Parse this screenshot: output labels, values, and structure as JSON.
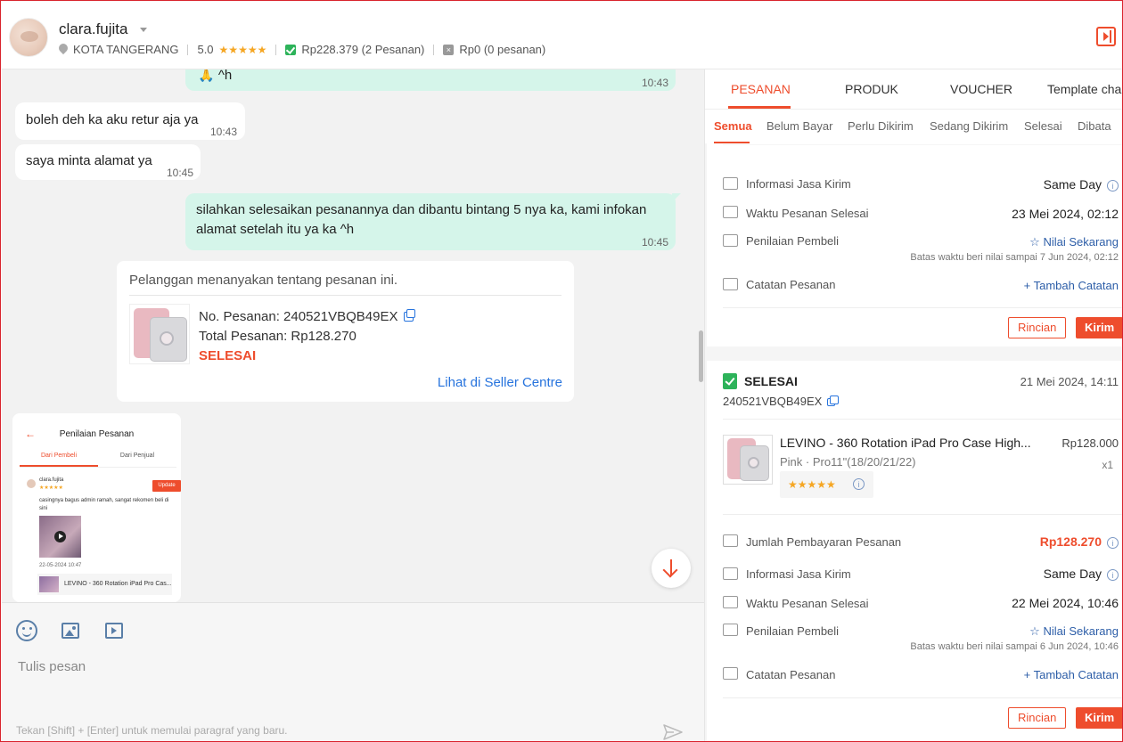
{
  "header": {
    "username": "clara.fujita",
    "location": "KOTA TANGERANG",
    "rating": "5.0",
    "stars": "★★★★★",
    "completed_orders": "Rp228.379 (2 Pesanan)",
    "other_orders": "Rp0 (0 pesanan)"
  },
  "chat": {
    "messages": [
      {
        "direction": "out",
        "text": "🙏 ^h",
        "time": "10:43"
      },
      {
        "direction": "in",
        "text": "boleh deh ka aku retur aja ya",
        "time": "10:43"
      },
      {
        "direction": "in",
        "text": "saya minta alamat ya",
        "time": "10:45"
      },
      {
        "direction": "out",
        "text": "silahkan selesaikan pesanannya dan dibantu bintang 5 nya ka, kami infokan alamat setelah itu ya ka ^h",
        "time": "10:45"
      }
    ],
    "order_card": {
      "question": "Pelanggan menanyakan tentang pesanan ini.",
      "order_no": "No. Pesanan: 240521VBQB49EX",
      "total": "Total Pesanan: Rp128.270",
      "status": "SELESAI",
      "link": "Lihat di Seller Centre"
    },
    "screenshot": {
      "title": "Penilaian Pesanan",
      "tab_buyer": "Dari Pembeli",
      "tab_seller": "Dari Penjual",
      "user": "clara.fujita",
      "stars": "★★★★★",
      "update": "Update",
      "review": "casingnya bagus admin ramah, sangat rekomen beli di sini",
      "date": "22-05-2024 10:47",
      "product": "LEVINO - 360 Rotation iPad Pro Cas..."
    }
  },
  "composer": {
    "placeholder": "Tulis pesan",
    "hint": "Tekan [Shift] + [Enter] untuk memulai paragraf yang baru."
  },
  "panel": {
    "tabs": [
      "PESANAN",
      "PRODUK",
      "VOUCHER",
      "Template cha"
    ],
    "subtabs": [
      "Semua",
      "Belum Bayar",
      "Perlu Dikirim",
      "Sedang Dikirim",
      "Selesai",
      "Dibata"
    ],
    "order1": {
      "shipping_label": "Informasi Jasa Kirim",
      "shipping_value": "Same Day",
      "completed_label": "Waktu Pesanan Selesai",
      "completed_value": "23 Mei 2024, 02:12",
      "rating_label": "Penilaian Pembeli",
      "rating_value": "Nilai Sekarang",
      "rating_note": "Batas waktu beri nilai sampai 7 Jun 2024, 02:12",
      "notes_label": "Catatan Pesanan",
      "notes_value": "Tambah Catatan",
      "btn_detail": "Rincian",
      "btn_send": "Kirim"
    },
    "order2": {
      "status": "SELESAI",
      "date": "21 Mei 2024, 14:11",
      "order_no": "240521VBQB49EX",
      "product_name": "LEVINO - 360 Rotation iPad Pro Case High...",
      "variant": "Pink · Pro11\"(18/20/21/22)",
      "price": "Rp128.000",
      "qty": "x1",
      "stars": "★★★★★",
      "payment_label": "Jumlah Pembayaran Pesanan",
      "payment_value": "Rp128.270",
      "shipping_label": "Informasi Jasa Kirim",
      "shipping_value": "Same Day",
      "completed_label": "Waktu Pesanan Selesai",
      "completed_value": "22 Mei 2024, 10:46",
      "rating_label": "Penilaian Pembeli",
      "rating_value": "Nilai Sekarang",
      "rating_note": "Batas waktu beri nilai sampai 6 Jun 2024, 10:46",
      "notes_label": "Catatan Pesanan",
      "notes_value": "Tambah Catatan",
      "btn_detail": "Rincian",
      "btn_send": "Kirim"
    }
  },
  "colors": {
    "accent": "#ee4d2d",
    "outgoing_bubble": "#d5f5ea",
    "link": "#2673dd",
    "success": "#2db35a"
  }
}
